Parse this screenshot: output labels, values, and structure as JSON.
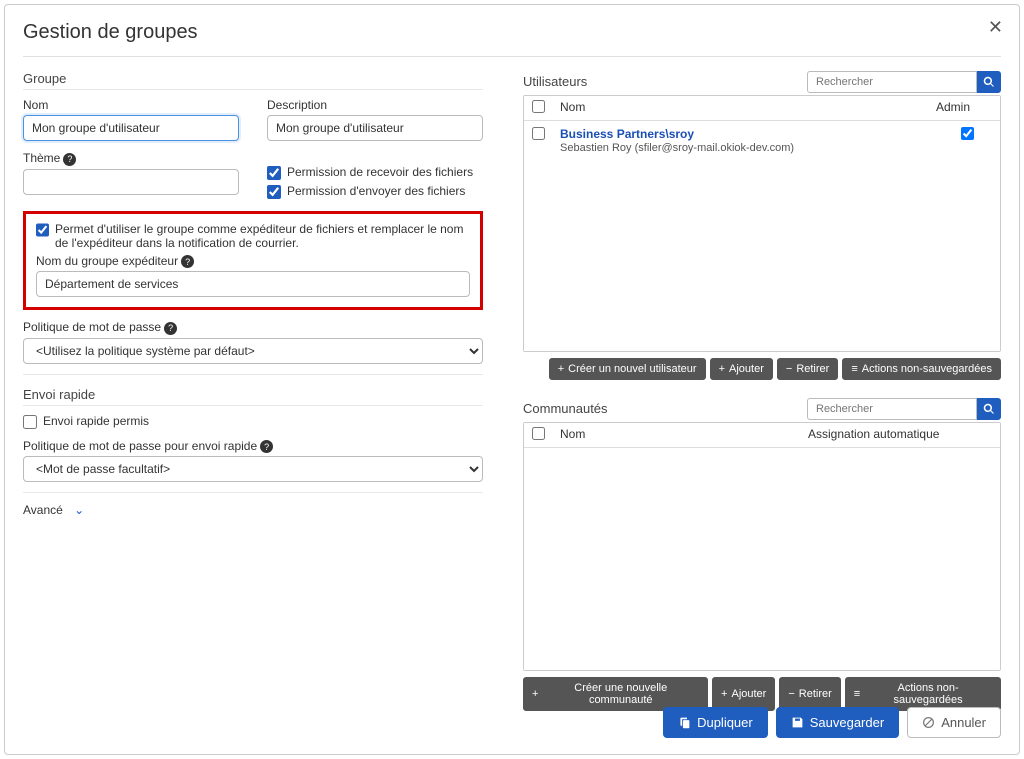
{
  "modal_title": "Gestion de groupes",
  "left": {
    "groupe_section": "Groupe",
    "nom_label": "Nom",
    "nom_value": "Mon groupe d'utilisateur",
    "desc_label": "Description",
    "desc_value": "Mon groupe d'utilisateur",
    "theme_label": "Thème",
    "perm_recv": "Permission de recevoir des fichiers",
    "perm_send": "Permission d'envoyer des fichiers",
    "sender_cb": "Permet d'utiliser le groupe comme expéditeur de fichiers et remplacer le nom de l'expéditeur dans la notification de courrier.",
    "sender_label": "Nom du groupe expéditeur",
    "sender_value": "Département de services",
    "pwd_policy_label": "Politique de mot de passe",
    "pwd_policy_value": "<Utilisez la politique système par défaut>",
    "quicksend_section": "Envoi rapide",
    "quicksend_allowed": "Envoi rapide permis",
    "quicksend_pwd_label": "Politique de mot de passe pour envoi rapide",
    "quicksend_pwd_value": "<Mot de passe facultatif>",
    "advanced": "Avancé"
  },
  "users": {
    "title": "Utilisateurs",
    "search_placeholder": "Rechercher",
    "col_nom": "Nom",
    "col_admin": "Admin",
    "row1_name": "Business Partners\\sroy",
    "row1_sub": "Sebastien Roy (sfiler@sroy-mail.okiok-dev.com)",
    "btn_new": "Créer un nouvel utilisateur",
    "btn_add": "Ajouter",
    "btn_remove": "Retirer",
    "btn_unsaved": "Actions non-sauvegardées"
  },
  "comm": {
    "title": "Communautés",
    "search_placeholder": "Rechercher",
    "col_nom": "Nom",
    "col_assign": "Assignation automatique",
    "btn_new": "Créer une nouvelle communauté",
    "btn_add": "Ajouter",
    "btn_remove": "Retirer",
    "btn_unsaved": "Actions non-sauvegardées"
  },
  "footer": {
    "dup": "Dupliquer",
    "save": "Sauvegarder",
    "cancel": "Annuler"
  }
}
